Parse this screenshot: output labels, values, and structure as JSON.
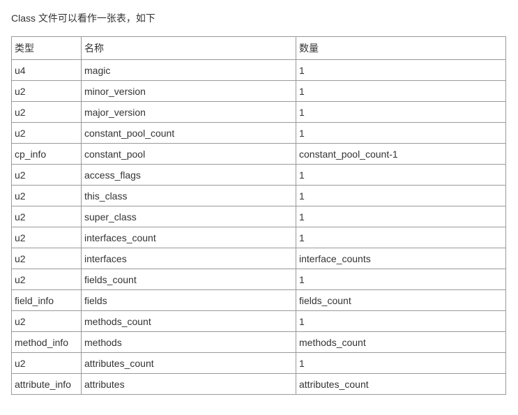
{
  "intro": "Class 文件可以看作一张表，如下",
  "table": {
    "headers": {
      "type": "类型",
      "name": "名称",
      "count": "数量"
    },
    "rows": [
      {
        "type": "u4",
        "name": "magic",
        "count": "1"
      },
      {
        "type": "u2",
        "name": "minor_version",
        "count": "1"
      },
      {
        "type": "u2",
        "name": "major_version",
        "count": "1"
      },
      {
        "type": "u2",
        "name": "constant_pool_count",
        "count": "1"
      },
      {
        "type": "cp_info",
        "name": "constant_pool",
        "count": "constant_pool_count-1"
      },
      {
        "type": "u2",
        "name": "access_flags",
        "count": "1"
      },
      {
        "type": "u2",
        "name": "this_class",
        "count": "1"
      },
      {
        "type": "u2",
        "name": "super_class",
        "count": "1"
      },
      {
        "type": "u2",
        "name": "interfaces_count",
        "count": "1"
      },
      {
        "type": "u2",
        "name": "interfaces",
        "count": "interface_counts"
      },
      {
        "type": "u2",
        "name": "fields_count",
        "count": "1"
      },
      {
        "type": "field_info",
        "name": "fields",
        "count": "fields_count"
      },
      {
        "type": "u2",
        "name": "methods_count",
        "count": "1"
      },
      {
        "type": "method_info",
        "name": "methods",
        "count": "methods_count"
      },
      {
        "type": "u2",
        "name": "attributes_count",
        "count": "1"
      },
      {
        "type": "attribute_info",
        "name": "attributes",
        "count": "attributes_count"
      }
    ]
  }
}
